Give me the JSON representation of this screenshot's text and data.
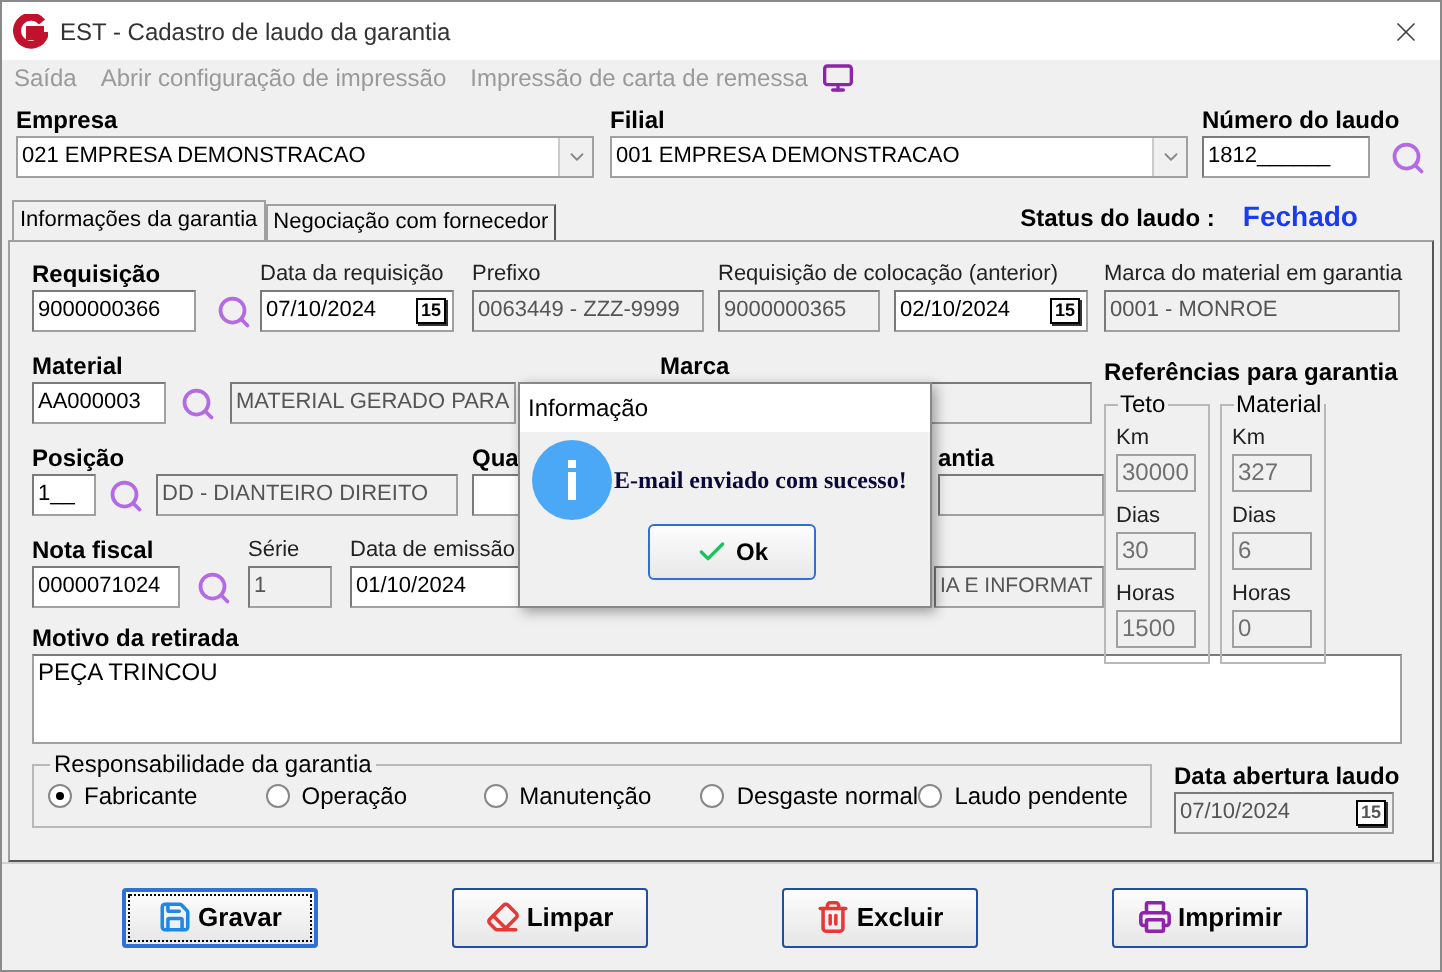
{
  "window": {
    "title": "EST - Cadastro de laudo da garantia"
  },
  "menu": [
    {
      "label": "Saída",
      "disabled": true
    },
    {
      "label": "Abrir configuração de impressão",
      "disabled": true
    },
    {
      "label": "Impressão de carta de remessa",
      "disabled": true
    }
  ],
  "header": {
    "empresa": {
      "label": "Empresa",
      "value": "021 EMPRESA DEMONSTRACAO"
    },
    "filial": {
      "label": "Filial",
      "value": "001 EMPRESA DEMONSTRACAO"
    },
    "numero": {
      "label": "Número do laudo",
      "value": "1812______"
    }
  },
  "tabs": [
    {
      "label": "Informações da garantia",
      "selected": true
    },
    {
      "label": "Negociação com fornecedor",
      "selected": false
    }
  ],
  "status": {
    "label": "Status do laudo :",
    "value": "Fechado"
  },
  "requisicao": {
    "label": "Requisição",
    "value": "9000000366",
    "disabled": false
  },
  "data_requisicao": {
    "label": "Data da requisição",
    "value": "07/10/2024",
    "disabled": false,
    "calendar_text": "15"
  },
  "prefixo": {
    "label": "Prefixo",
    "value": "0063449 - ZZZ-9999",
    "disabled": true
  },
  "requisicao_colocacao": {
    "label": "Requisição de colocação (anterior)",
    "value": "9000000365",
    "disabled": true
  },
  "data_colocacao": {
    "value": "02/10/2024",
    "disabled": false,
    "calendar_text": "15"
  },
  "marca_material": {
    "label": "Marca do material em garantia",
    "value": "0001 - MONROE",
    "disabled": true
  },
  "material": {
    "label": "Material",
    "value": "AA000003",
    "disabled": false
  },
  "material_descricao": {
    "value": "MATERIAL GERADO PARA",
    "disabled": true
  },
  "marca": {
    "label": "Marca",
    "disabled": true
  },
  "posicao": {
    "label": "Posição",
    "value": "1__",
    "disabled": false
  },
  "posicao_descricao": {
    "value": "DD - DIANTEIRO DIREITO",
    "disabled": true
  },
  "column_qua": {
    "label": "Qua",
    "disabled": false
  },
  "column_antia": {
    "label": "antia",
    "disabled": true
  },
  "nota_fiscal": {
    "label": "Nota fiscal",
    "value": "0000071024",
    "disabled": false
  },
  "serie": {
    "label": "Série",
    "value": "1",
    "disabled": true
  },
  "data_emissao": {
    "label": "Data de emissão",
    "value": "01/10/2024",
    "disabled": false
  },
  "fornecedor": {
    "value": "IA E INFORMAT",
    "disabled": true
  },
  "referencias": {
    "title": "Referências para garantia",
    "groups": [
      {
        "title": "Teto",
        "rows": [
          {
            "label": "Km",
            "value": "30000"
          },
          {
            "label": "Dias",
            "value": "30"
          },
          {
            "label": "Horas",
            "value": "1500"
          }
        ]
      },
      {
        "title": "Material",
        "rows": [
          {
            "label": "Km",
            "value": "327"
          },
          {
            "label": "Dias",
            "value": "6"
          },
          {
            "label": "Horas",
            "value": "0"
          }
        ]
      }
    ]
  },
  "motivo": {
    "label": "Motivo da retirada",
    "value": "PEÇA TRINCOU"
  },
  "responsabilidade": {
    "title": "Responsabilidade da garantia",
    "options": [
      {
        "label": "Fabricante",
        "selected": true
      },
      {
        "label": "Operação",
        "selected": false
      },
      {
        "label": "Manutenção",
        "selected": false
      },
      {
        "label": "Desgaste normal",
        "selected": false
      },
      {
        "label": "Laudo pendente",
        "selected": false
      }
    ]
  },
  "data_abertura": {
    "label": "Data abertura laudo",
    "value": "07/10/2024",
    "disabled": true,
    "calendar_text": "15"
  },
  "buttons": [
    {
      "label": "Gravar",
      "kind": "save",
      "focused": true
    },
    {
      "label": "Limpar",
      "kind": "clear",
      "focused": false
    },
    {
      "label": "Excluir",
      "kind": "delete",
      "focused": false
    },
    {
      "label": "Imprimir",
      "kind": "print",
      "focused": false
    }
  ],
  "dialog": {
    "title": "Informação",
    "message": "E-mail enviado com sucesso!",
    "button": "Ok"
  }
}
